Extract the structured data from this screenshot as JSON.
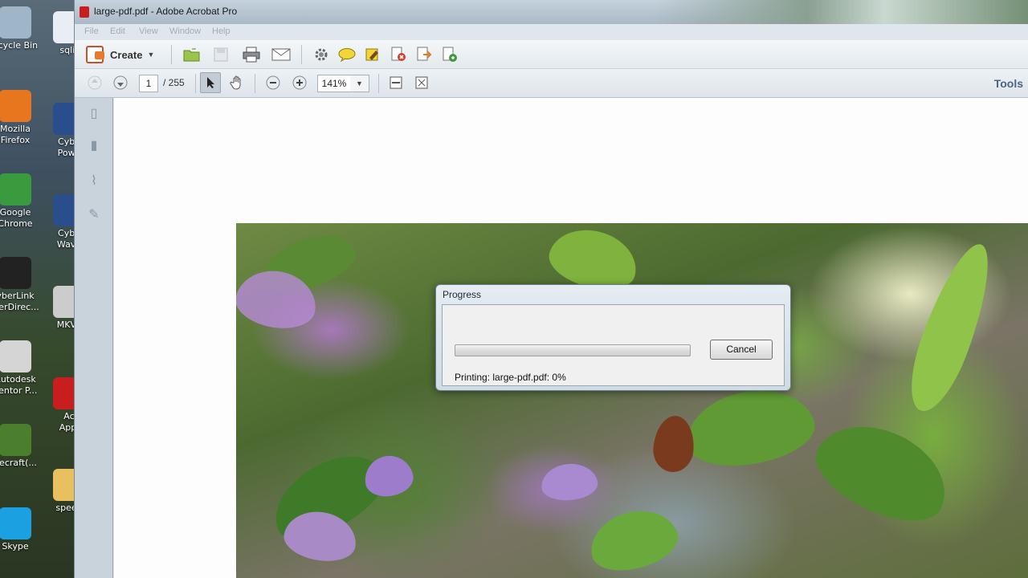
{
  "desktop": {
    "icons": [
      {
        "label": "Recycle Bin",
        "display": "ecycle Bin",
        "icon": "recycle-bin-icon",
        "color": "#9fb6c8"
      },
      {
        "label": "Mozilla Firefox",
        "display": "Mozilla\nFirefox",
        "icon": "firefox-icon",
        "color": "#e8761e"
      },
      {
        "label": "Google Chrome",
        "display": "Google\nChrome",
        "icon": "chrome-icon",
        "color": "#3a9b3e"
      },
      {
        "label": "CyberLink PowerDirector",
        "display": "yberLink\nwerDirec...",
        "icon": "cyberlink-icon",
        "color": "#222222"
      },
      {
        "label": "Autodesk Inventor Professional",
        "display": "Autodesk\nventor P...",
        "icon": "autodesk-icon",
        "color": "#d5d5d5"
      },
      {
        "label": "Minecraft",
        "display": "necraft(...",
        "icon": "minecraft-icon",
        "color": "#4b7f2e"
      },
      {
        "label": "Skype",
        "display": "Skype",
        "icon": "skype-icon",
        "color": "#1ba1e2"
      }
    ],
    "icons_col2": [
      {
        "display": "sqlit",
        "icon": "sqlite-icon",
        "color": "#e8eef3"
      },
      {
        "display": "Cybe\nPowe",
        "icon": "cyberlink-power-icon",
        "color": "#2a4e8c"
      },
      {
        "display": "Cybe\nWave",
        "icon": "cyberlink-wave-icon",
        "color": "#2a4e8c"
      },
      {
        "display": "MKVF",
        "icon": "mkv-icon",
        "color": "#cccccc"
      },
      {
        "display": "Ac\nAppl",
        "icon": "adobe-app-icon",
        "color": "#c81e1e"
      },
      {
        "display": "speed",
        "icon": "folder-icon",
        "color": "#e8c060"
      }
    ]
  },
  "window": {
    "title": "large-pdf.pdf - Adobe Acrobat Pro",
    "menu": [
      "File",
      "Edit",
      "View",
      "Window",
      "Help"
    ]
  },
  "toolbar": {
    "create_label": "Create",
    "page_current": "1",
    "page_total": "/ 255",
    "zoom": "141%",
    "tools_label": "Tools"
  },
  "dialog": {
    "title": "Progress",
    "cancel_label": "Cancel",
    "status": "Printing: large-pdf.pdf: 0%",
    "progress_fraction": 0,
    "progress_color": "#3cb14a"
  }
}
